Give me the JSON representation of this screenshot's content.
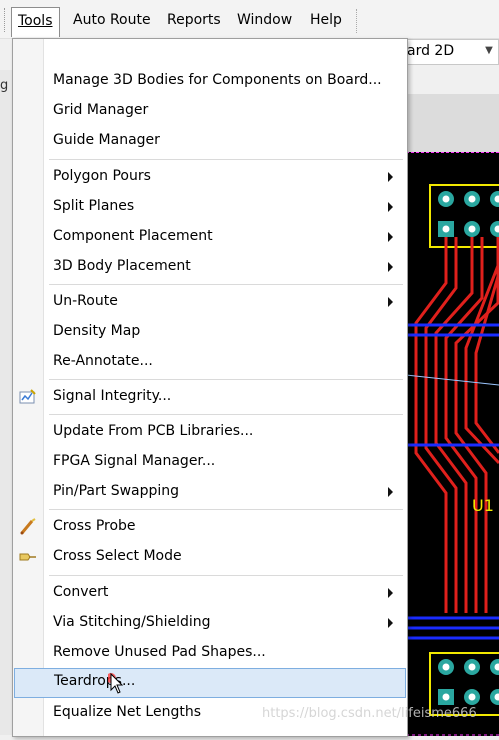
{
  "menubar": {
    "items": [
      {
        "label": "Tools",
        "active": true
      },
      {
        "label": "Auto Route",
        "active": false
      },
      {
        "label": "Reports",
        "active": false
      },
      {
        "label": "Window",
        "active": false
      },
      {
        "label": "Help",
        "active": false
      }
    ]
  },
  "view_combo": {
    "value": "ard 2D"
  },
  "left_edge_text": "g",
  "pcb": {
    "component_label": "U1"
  },
  "tools_menu": {
    "items": [
      {
        "label": "Manage 3D Bodies for Components on Board...",
        "submenu": false
      },
      {
        "label": "Grid Manager",
        "submenu": false
      },
      {
        "label": "Guide Manager",
        "submenu": false
      },
      {
        "label": "Polygon Pours",
        "submenu": true
      },
      {
        "label": "Split Planes",
        "submenu": true
      },
      {
        "label": "Component Placement",
        "submenu": true
      },
      {
        "label": "3D Body Placement",
        "submenu": true
      },
      {
        "label": "Un-Route",
        "submenu": true
      },
      {
        "label": "Density Map",
        "submenu": false
      },
      {
        "label": "Re-Annotate...",
        "submenu": false
      },
      {
        "label": "Signal Integrity...",
        "submenu": false,
        "icon": "signal-integrity-icon"
      },
      {
        "label": "Update From PCB Libraries...",
        "submenu": false
      },
      {
        "label": "FPGA Signal Manager...",
        "submenu": false
      },
      {
        "label": "Pin/Part Swapping",
        "submenu": true
      },
      {
        "label": "Cross Probe",
        "submenu": false,
        "icon": "cross-probe-icon"
      },
      {
        "label": "Cross Select Mode",
        "submenu": false,
        "icon": "cross-select-icon"
      },
      {
        "label": "Convert",
        "submenu": true
      },
      {
        "label": "Via Stitching/Shielding",
        "submenu": true
      },
      {
        "label": "Remove Unused Pad Shapes...",
        "submenu": false
      },
      {
        "label": "Teardrops...",
        "submenu": false,
        "highlighted": true
      },
      {
        "label": "Equalize Net Lengths",
        "submenu": false
      }
    ]
  },
  "watermark": "https://blog.csdn.net/lifeisme666",
  "colors": {
    "trace_red": "#e0201c",
    "net_blue": "#1a2cff",
    "silkscreen_yellow": "#f2e800",
    "pad_cyan": "#2aa7a0",
    "board_outline_magenta": "#ff33ff",
    "highlight_bg": "#dbe9f8"
  }
}
